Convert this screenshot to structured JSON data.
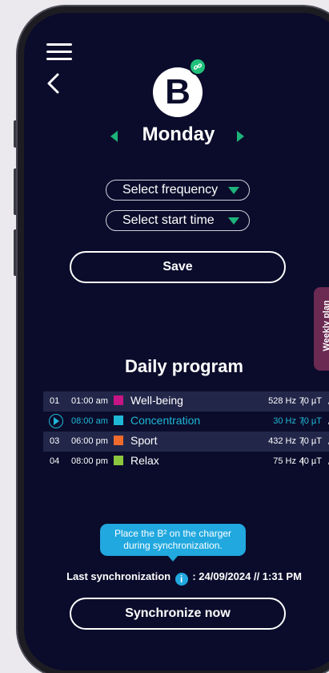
{
  "header": {
    "logo_letter": "B"
  },
  "day": {
    "label": "Monday"
  },
  "selects": {
    "frequency": "Select frequency",
    "start_time": "Select start time"
  },
  "buttons": {
    "save": "Save",
    "sync": "Synchronize now"
  },
  "program": {
    "title": "Daily program",
    "rows": [
      {
        "num": "01",
        "time": "01:00 am",
        "color": "#c71585",
        "name": "Well-being",
        "freq": "528 Hz",
        "power": "70 µT"
      },
      {
        "num": "",
        "time": "08:00 am",
        "color": "#1fb7d6",
        "name": "Concentration",
        "freq": "30 Hz",
        "power": "70 µT"
      },
      {
        "num": "03",
        "time": "06:00 pm",
        "color": "#ef6a2b",
        "name": "Sport",
        "freq": "432 Hz",
        "power": "70 µT"
      },
      {
        "num": "04",
        "time": "08:00 pm",
        "color": "#8cc63f",
        "name": "Relax",
        "freq": "75 Hz",
        "power": "40 µT"
      }
    ],
    "sep": "|"
  },
  "tooltip": {
    "line1": "Place the B² on the charger",
    "line2": "during synchronization."
  },
  "sync": {
    "label": "Last synchronization",
    "info": "i",
    "value": ": 24/09/2024 // 1:31 PM"
  },
  "side_tab": {
    "label": "Weekly plan"
  },
  "colors": {
    "accent": "#1db37a",
    "background": "#0b0c2b",
    "info": "#21a8df",
    "tab": "#6b2a52"
  }
}
